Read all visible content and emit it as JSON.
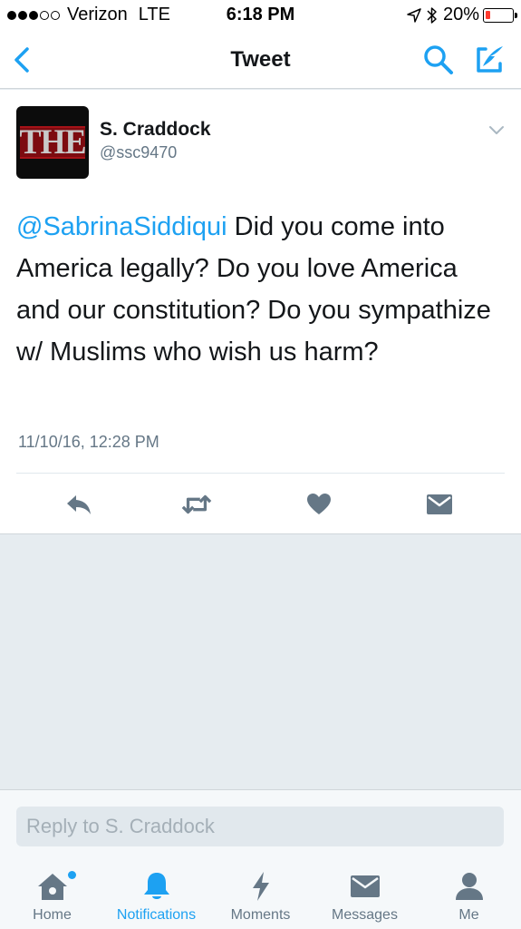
{
  "status_bar": {
    "carrier": "Verizon",
    "network": "LTE",
    "time": "6:18 PM",
    "battery_percent": "20%",
    "battery_level": 0.2,
    "signal_bars_filled": 3,
    "signal_bars_total": 5
  },
  "nav": {
    "title": "Tweet",
    "icons": {
      "back": "chevron-left-icon",
      "search": "search-icon",
      "compose": "compose-icon"
    }
  },
  "tweet": {
    "display_name": "S. Craddock",
    "handle": "@ssc9470",
    "avatar_text": "THE",
    "mention": "@SabrinaSiddiqui",
    "body": " Did you come into America legally? Do you love America and our constitution? Do you sympathize w/ Muslims who wish us harm?",
    "timestamp": "11/10/16, 12:28 PM",
    "actions": [
      "reply-icon",
      "retweet-icon",
      "like-icon",
      "direct-message-icon"
    ]
  },
  "reply": {
    "placeholder": "Reply to S. Craddock"
  },
  "tabs": [
    {
      "label": "Home",
      "icon": "home-icon",
      "active": false
    },
    {
      "label": "Notifications",
      "icon": "bell-icon",
      "active": true
    },
    {
      "label": "Moments",
      "icon": "lightning-icon",
      "active": false
    },
    {
      "label": "Messages",
      "icon": "envelope-icon",
      "active": false
    },
    {
      "label": "Me",
      "icon": "person-icon",
      "active": false
    }
  ],
  "colors": {
    "accent": "#1da1f2",
    "text": "#14171a",
    "secondary_text": "#657786",
    "icon_gray": "#657786",
    "battery_low": "#ff3b30"
  }
}
